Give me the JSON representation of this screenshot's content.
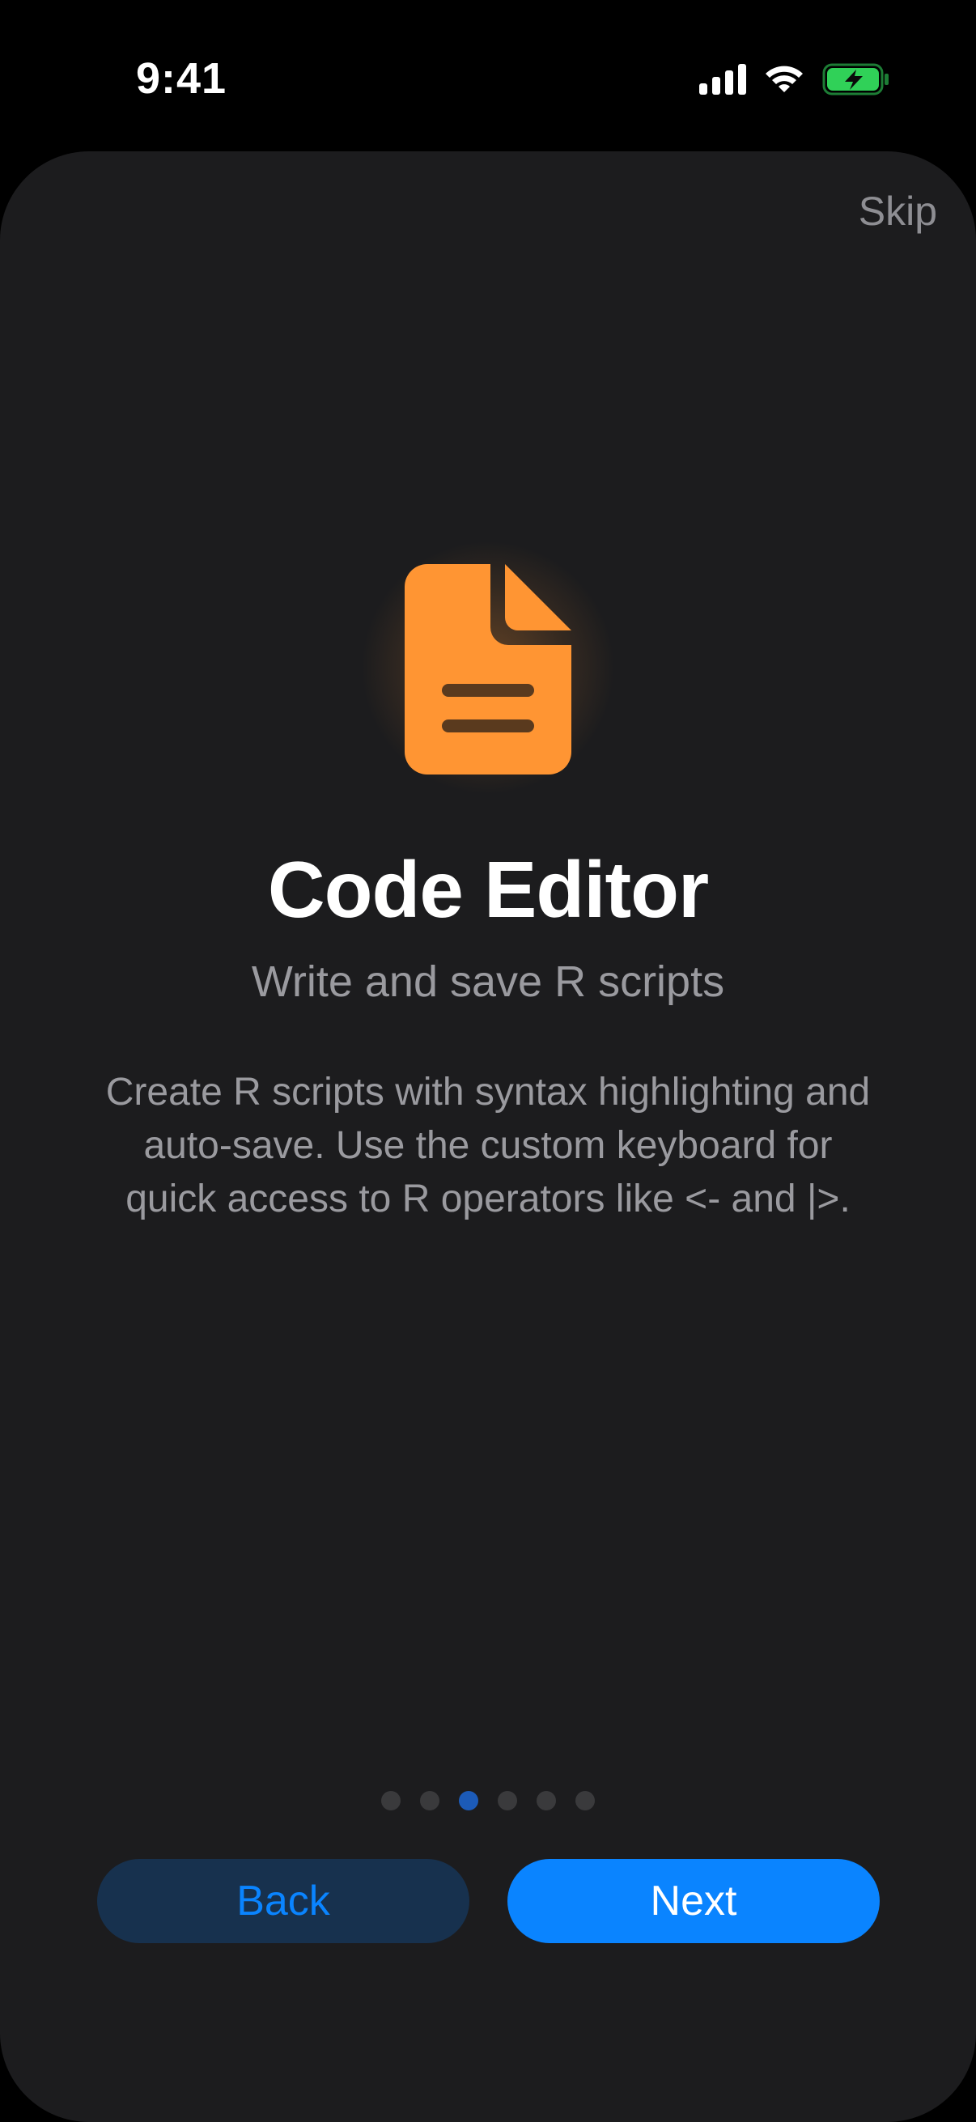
{
  "status_bar": {
    "time": "9:41",
    "icons": [
      "cellular-signal-icon",
      "wifi-icon",
      "battery-charging-icon"
    ]
  },
  "onboarding": {
    "skip_label": "Skip",
    "icon": "document-icon",
    "title": "Code Editor",
    "subtitle": "Write and save R scripts",
    "description": "Create R scripts with syntax highlighting and auto-save. Use the custom keyboard for quick access to R operators like <- and |>.",
    "page_indicator": {
      "total": 6,
      "current": 3
    },
    "back_label": "Back",
    "next_label": "Next"
  },
  "colors": {
    "accent": "#0a84ff",
    "icon": "#ff9533",
    "background": "#1c1c1e",
    "battery": "#30d158"
  }
}
